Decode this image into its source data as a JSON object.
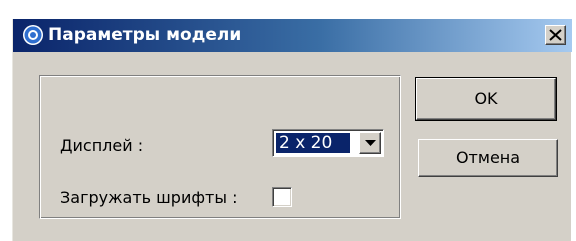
{
  "window": {
    "title": "Параметры модели",
    "close_glyph": "✕"
  },
  "icons": {
    "title": "app-settings-icon",
    "close": "close-icon",
    "dropdown": "chevron-down-icon"
  },
  "colors": {
    "titlebar_start": "#0a246a",
    "titlebar_end": "#a6caf0",
    "face": "#d4d0c8",
    "selection": "#0a246a"
  },
  "form": {
    "display_label": "Дисплей :",
    "display_value": "2 x 20",
    "load_fonts_label": "Загружать шрифты :",
    "load_fonts_checked": false
  },
  "buttons": {
    "ok": "OK",
    "cancel": "Отмена"
  }
}
